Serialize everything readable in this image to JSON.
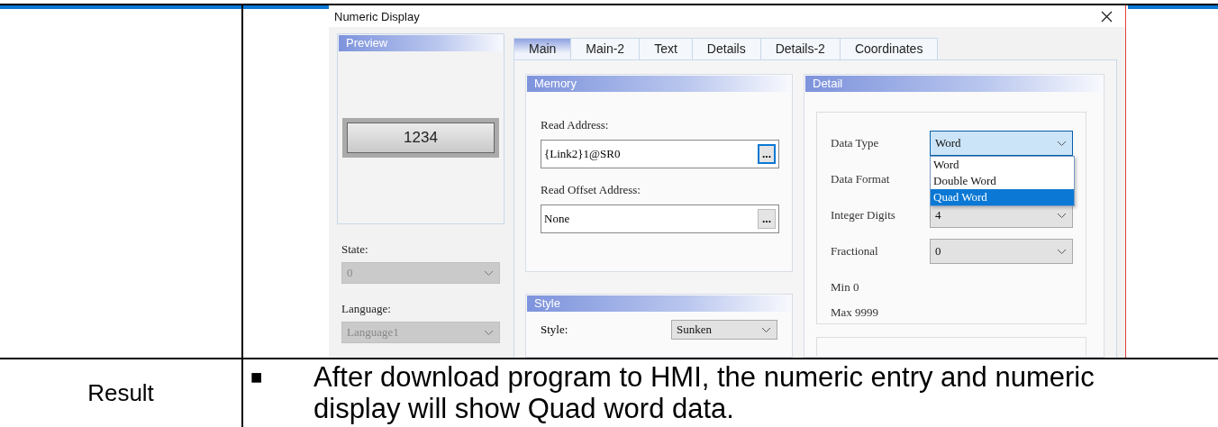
{
  "dialog": {
    "title": "Numeric Display",
    "preview": {
      "header": "Preview",
      "value": "1234"
    },
    "state": {
      "label": "State:",
      "value": "0",
      "disabled": true
    },
    "language": {
      "label": "Language:",
      "value": "Language1",
      "disabled": true
    },
    "tabs": [
      {
        "label": "Main",
        "selected": true
      },
      {
        "label": "Main-2",
        "selected": false
      },
      {
        "label": "Text",
        "selected": false
      },
      {
        "label": "Details",
        "selected": false
      },
      {
        "label": "Details-2",
        "selected": false
      },
      {
        "label": "Coordinates",
        "selected": false
      }
    ],
    "memory": {
      "header": "Memory",
      "fields": [
        {
          "label": "Read Address:",
          "value": "{Link2}1@SR0",
          "button": "...",
          "focused": true
        },
        {
          "label": "Read Offset Address:",
          "value": "None",
          "button": "...",
          "focused": false
        }
      ]
    },
    "style": {
      "header": "Style",
      "label": "Style:",
      "value": "Sunken"
    },
    "detail": {
      "header": "Detail",
      "rows": [
        {
          "label": "Data Type",
          "kind": "open",
          "value": "Word",
          "options": [
            {
              "label": "Word",
              "highlighted": false
            },
            {
              "label": "Double Word",
              "highlighted": false
            },
            {
              "label": "Quad Word",
              "highlighted": true
            }
          ]
        },
        {
          "label": "Data Format",
          "kind": "covered"
        },
        {
          "label": "Integer Digits",
          "kind": "select",
          "value": "4"
        },
        {
          "label": "Fractional",
          "kind": "select",
          "value": "0"
        }
      ],
      "min": "Min 0",
      "max": "Max 9999"
    }
  },
  "result": {
    "label": "Result",
    "bullet": "■",
    "text": "After download program to HMI, the numeric entry and numeric display will show Quad word data."
  }
}
